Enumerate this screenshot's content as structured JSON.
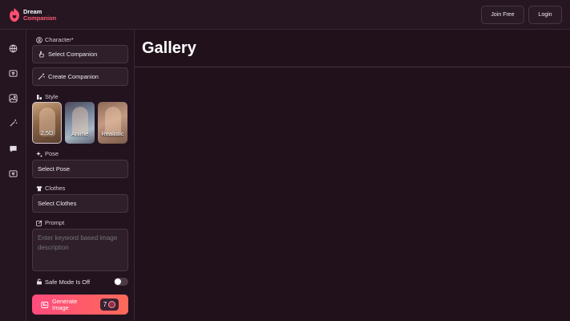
{
  "brand": {
    "line1": "Dream",
    "line2": "Companion"
  },
  "header": {
    "join_label": "Join Free",
    "login_label": "Login"
  },
  "rail": {
    "icons": [
      "globe-icon",
      "image-heart-icon",
      "gallery-icon",
      "magic-wand-icon",
      "chat-icon",
      "image-heart-alt-icon"
    ]
  },
  "form": {
    "character_label": "Character*",
    "select_companion": "Select Companion",
    "create_companion": "Create Companion",
    "style_label": "Style",
    "styles": [
      {
        "label": "2.5D",
        "selected": true
      },
      {
        "label": "Anime",
        "selected": false
      },
      {
        "label": "Realistic",
        "selected": false
      }
    ],
    "pose_label": "Pose",
    "pose_value": "Select Pose",
    "clothes_label": "Clothes",
    "clothes_value": "Select Clothes",
    "prompt_label": "Prompt",
    "prompt_placeholder": "Enter keyword based image description",
    "safe_mode_label": "Safe Mode Is Off",
    "safe_mode_on": false,
    "generate_label": "Generate Image",
    "generate_cost": "7"
  },
  "main": {
    "title": "Gallery"
  },
  "colors": {
    "accent": "#ff4b7e",
    "accent2": "#ff6a59",
    "background": "#1f111b"
  }
}
